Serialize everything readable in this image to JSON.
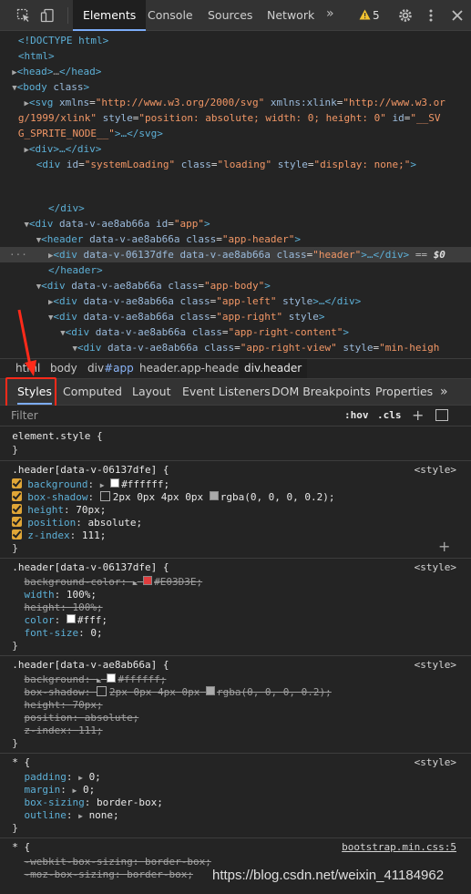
{
  "toolbar": {
    "tabs": [
      "Elements",
      "Console",
      "Sources",
      "Network"
    ],
    "more": "»",
    "warning_count": "5",
    "icons": [
      "inspect-icon",
      "device-icon",
      "warning-icon",
      "gear-icon",
      "kebab-icon",
      "close-icon"
    ]
  },
  "dom": {
    "l0": "<!DOCTYPE html>",
    "l1_tag": "<html>",
    "l2_head": "<head>",
    "l2_dots": "…",
    "l2_close": "</head>",
    "l3_body": "<body",
    "l3_attr": "class",
    "l3_close": ">",
    "l4_tag": "<svg",
    "l4_a1": "xmlns",
    "l4_v1": "\"http://www.w3.org/2000/svg\"",
    "l4_a2": "xmlns:xlink",
    "l4_v2": "\"http://www.w3.or",
    "l5_v2": "g/1999/xlink\"",
    "l5_a3": "style",
    "l5_v3": "\"position: absolute; width: 0; height: 0\"",
    "l5_a4": "id",
    "l5_v4": "\"__SV",
    "l6_v4": "G_SPRITE_NODE__\"",
    "l6_close": ">…</svg>",
    "l7": "<div>…</div>",
    "l8_tag": "<div",
    "l8_a1": "id",
    "l8_v1": "\"systemLoading\"",
    "l8_a2": "class",
    "l8_v2": "\"loading\"",
    "l8_a3": "style",
    "l8_v3": "\"display: none;\"",
    "l8_close": ">",
    "l9": "</div>",
    "l10_tag": "<div",
    "l10_a1": "data-v-ae8ab66a",
    "l10_a2": "id",
    "l10_v2": "\"app\"",
    "l11_tag": "<header",
    "l11_a1": "data-v-ae8ab66a",
    "l11_a2": "class",
    "l11_v2": "\"app-header\"",
    "l12_tag": "<div",
    "l12_a1": "data-v-06137dfe",
    "l12_a2": "data-v-ae8ab66a",
    "l12_a3": "class",
    "l12_v3": "\"header\"",
    "l12_close": ">…</div>",
    "l12_eq": "== ",
    "l12_dollar": "$0",
    "l12_gutter": "···",
    "l13": "</header>",
    "l14_tag": "<div",
    "l14_a1": "data-v-ae8ab66a",
    "l14_a2": "class",
    "l14_v2": "\"app-body\"",
    "l15_tag": "<div",
    "l15_a1": "data-v-ae8ab66a",
    "l15_a2": "class",
    "l15_v2": "\"app-left\"",
    "l15_a3": "style",
    "l15_close": ">…</div>",
    "l16_tag": "<div",
    "l16_a1": "data-v-ae8ab66a",
    "l16_a2": "class",
    "l16_v2": "\"app-right\"",
    "l16_a3": "style",
    "l17_tag": "<div",
    "l17_a1": "data-v-ae8ab66a",
    "l17_a2": "class",
    "l17_v2": "\"app-right-content\"",
    "l18_tag": "<div",
    "l18_a1": "data-v-ae8ab66a",
    "l18_a2": "class",
    "l18_v2": "\"app-right-view\"",
    "l18_a3": "style",
    "l18_v3": "\"min-heigh"
  },
  "breadcrumbs": {
    "html": "html",
    "body": "body",
    "app_tag": "div",
    "app_id": "#app",
    "header": "header.app-header",
    "active": "div.header"
  },
  "subtabs": [
    "Styles",
    "Computed",
    "Layout",
    "Event Listeners",
    "DOM Breakpoints",
    "Properties"
  ],
  "subtabs_more": "»",
  "filter": {
    "placeholder": "Filter",
    "hov": ":hov",
    "cls": ".cls",
    "plus": "+"
  },
  "styles": {
    "element_style": "element.style {",
    "close": "}",
    "r1": {
      "selector": ".header[data-v-06137dfe] {",
      "source": "<style>",
      "p1n": "background",
      "p1v": "#ffffff;",
      "p2n": "box-shadow",
      "p2v_a": "2px 0px 4px 0px",
      "p2v_b": "rgba(0, 0, 0, 0.2);",
      "p3n": "height",
      "p3v": "70px;",
      "p4n": "position",
      "p4v": "absolute;",
      "p5n": "z-index",
      "p5v": "111;"
    },
    "r2": {
      "selector": ".header[data-v-06137dfe] {",
      "source": "<style>",
      "p1n": "background-color",
      "p1v": "#E03D3E;",
      "p2n": "width",
      "p2v": "100%;",
      "p3n": "height",
      "p3v": "100%;",
      "p4n": "color",
      "p4v": "#fff;",
      "p5n": "font-size",
      "p5v": "0;"
    },
    "r3": {
      "selector": ".header[data-v-ae8ab66a] {",
      "source": "<style>",
      "p1n": "background",
      "p1v": "#ffffff;",
      "p2n": "box-shadow",
      "p2v_a": "2px 0px 4px 0px",
      "p2v_b": "rgba(0, 0, 0, 0.2);",
      "p3n": "height",
      "p3v": "70px;",
      "p4n": "position",
      "p4v": "absolute;",
      "p5n": "z-index",
      "p5v": "111;"
    },
    "r4": {
      "selector": "* {",
      "source": "<style>",
      "p1n": "padding",
      "p1v": "0;",
      "p2n": "margin",
      "p2v": "0;",
      "p3n": "box-sizing",
      "p3v": "border-box;",
      "p4n": "outline",
      "p4v": "none;"
    },
    "r5": {
      "selector": "* {",
      "source": "bootstrap.min.css:5",
      "p1n": "-webkit-box-sizing",
      "p1v": "border-box;",
      "p2n": "-moz-box-sizing",
      "p2v": "border-box;"
    }
  },
  "colors": {
    "accent": "#7cacf8",
    "swatch_white": "#ffffff",
    "swatch_red": "#E03D3E",
    "swatch_shadow": "#aaaaaa",
    "highlight": "#ff2a1a"
  },
  "watermark": "https://blog.csdn.net/weixin_41184962"
}
